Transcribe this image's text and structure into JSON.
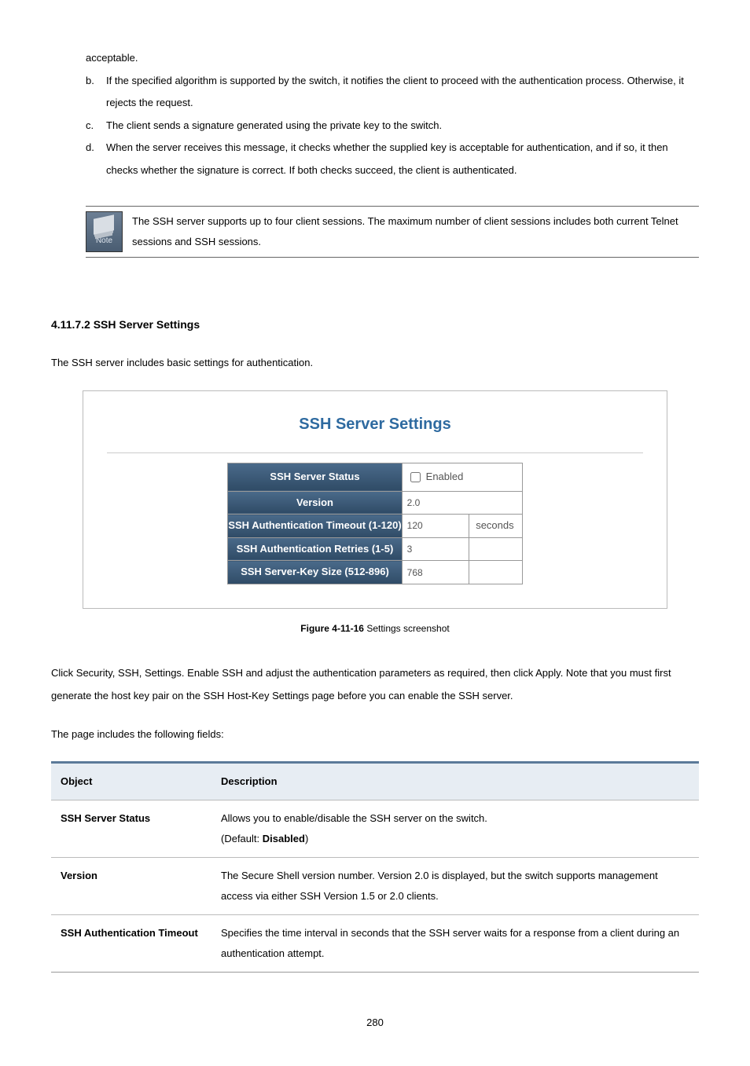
{
  "list": {
    "a_tail": "acceptable.",
    "b_marker": "b.",
    "b": "If the specified algorithm is supported by the switch, it notifies the client to proceed with the authentication process. Otherwise, it rejects the request.",
    "c_marker": "c.",
    "c": "The client sends a signature generated using the private key to the switch.",
    "d_marker": "d.",
    "d": "When the server receives this message, it checks whether the supplied key is acceptable for authentication, and if so, it then checks whether the signature is correct. If both checks succeed, the client is authenticated."
  },
  "note": {
    "icon_label": "Note",
    "text": "The SSH server supports up to four client sessions. The maximum number of client sessions includes both current Telnet sessions and SSH sessions."
  },
  "section_heading": "4.11.7.2 SSH Server Settings",
  "intro": "The SSH server includes basic settings for authentication.",
  "figure": {
    "title": "SSH Server Settings",
    "rows": {
      "status_label": "SSH Server Status",
      "status_checkbox_label": "Enabled",
      "version_label": "Version",
      "version_value": "2.0",
      "timeout_label": "SSH Authentication Timeout (1-120)",
      "timeout_value": "120",
      "timeout_unit": "seconds",
      "retries_label": "SSH Authentication Retries (1-5)",
      "retries_value": "3",
      "keysize_label": "SSH Server-Key Size (512-896)",
      "keysize_value": "768"
    }
  },
  "caption": {
    "bold": "Figure 4-11-16",
    "rest": " Settings screenshot"
  },
  "after_fig": "Click Security, SSH, Settings. Enable SSH and adjust the authentication parameters as required, then click Apply. Note that you must first generate the host key pair on the SSH Host-Key Settings page before you can enable the SSH server.",
  "fields_intro": "The page includes the following fields:",
  "fields": {
    "header_obj": "Object",
    "header_desc": "Description",
    "rows": [
      {
        "obj": "SSH Server Status",
        "desc_pre": "Allows you to enable/disable the SSH server on the switch.\n(Default: ",
        "desc_bold": "Disabled",
        "desc_post": ")"
      },
      {
        "obj": "Version",
        "desc_pre": "The Secure Shell version number. Version 2.0 is displayed, but the switch supports management access via either SSH Version 1.5 or 2.0 clients.",
        "desc_bold": "",
        "desc_post": ""
      },
      {
        "obj": "SSH Authentication Timeout",
        "desc_pre": "Specifies the time interval in seconds that the SSH server waits for a response from a client during an authentication attempt.",
        "desc_bold": "",
        "desc_post": ""
      }
    ]
  },
  "page_number": "280"
}
